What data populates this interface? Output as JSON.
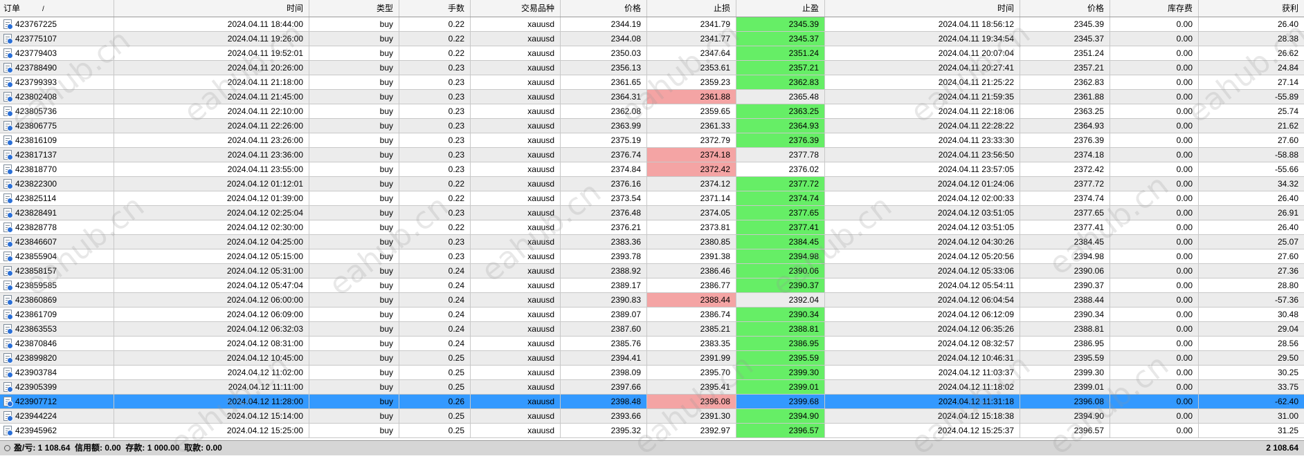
{
  "columns": {
    "order": "订单",
    "sort_indicator": "/",
    "time_open": "时间",
    "type": "类型",
    "lots": "手数",
    "symbol": "交易品种",
    "price_open": "价格",
    "sl": "止损",
    "tp": "止盈",
    "time_close": "时间",
    "price_close": "价格",
    "swap": "库存费",
    "profit": "获利"
  },
  "colors": {
    "tp_hit": "#66ee66",
    "sl_hit": "#f4a4a4",
    "selected_row": "#3399ff"
  },
  "icons": {
    "row_icon": "document-icon",
    "summary_icon": "circle-icon"
  },
  "selected_index": 26,
  "rows": [
    {
      "order": "423767225",
      "time_open": "2024.04.11 18:44:00",
      "type": "buy",
      "lots": "0.22",
      "symbol": "xauusd",
      "price_open": "2344.19",
      "sl": "2341.79",
      "tp": "2345.39",
      "time_close": "2024.04.11 18:56:12",
      "price_close": "2345.39",
      "swap": "0.00",
      "profit": "26.40",
      "hit": "tp"
    },
    {
      "order": "423775107",
      "time_open": "2024.04.11 19:26:00",
      "type": "buy",
      "lots": "0.22",
      "symbol": "xauusd",
      "price_open": "2344.08",
      "sl": "2341.77",
      "tp": "2345.37",
      "time_close": "2024.04.11 19:34:54",
      "price_close": "2345.37",
      "swap": "0.00",
      "profit": "28.38",
      "hit": "tp"
    },
    {
      "order": "423779403",
      "time_open": "2024.04.11 19:52:01",
      "type": "buy",
      "lots": "0.22",
      "symbol": "xauusd",
      "price_open": "2350.03",
      "sl": "2347.64",
      "tp": "2351.24",
      "time_close": "2024.04.11 20:07:04",
      "price_close": "2351.24",
      "swap": "0.00",
      "profit": "26.62",
      "hit": "tp"
    },
    {
      "order": "423788490",
      "time_open": "2024.04.11 20:26:00",
      "type": "buy",
      "lots": "0.23",
      "symbol": "xauusd",
      "price_open": "2356.13",
      "sl": "2353.61",
      "tp": "2357.21",
      "time_close": "2024.04.11 20:27:41",
      "price_close": "2357.21",
      "swap": "0.00",
      "profit": "24.84",
      "hit": "tp"
    },
    {
      "order": "423799393",
      "time_open": "2024.04.11 21:18:00",
      "type": "buy",
      "lots": "0.23",
      "symbol": "xauusd",
      "price_open": "2361.65",
      "sl": "2359.23",
      "tp": "2362.83",
      "time_close": "2024.04.11 21:25:22",
      "price_close": "2362.83",
      "swap": "0.00",
      "profit": "27.14",
      "hit": "tp"
    },
    {
      "order": "423802408",
      "time_open": "2024.04.11 21:45:00",
      "type": "buy",
      "lots": "0.23",
      "symbol": "xauusd",
      "price_open": "2364.31",
      "sl": "2361.88",
      "tp": "2365.48",
      "time_close": "2024.04.11 21:59:35",
      "price_close": "2361.88",
      "swap": "0.00",
      "profit": "-55.89",
      "hit": "sl"
    },
    {
      "order": "423805736",
      "time_open": "2024.04.11 22:10:00",
      "type": "buy",
      "lots": "0.23",
      "symbol": "xauusd",
      "price_open": "2362.08",
      "sl": "2359.65",
      "tp": "2363.25",
      "time_close": "2024.04.11 22:18:06",
      "price_close": "2363.25",
      "swap": "0.00",
      "profit": "25.74",
      "hit": "tp"
    },
    {
      "order": "423806775",
      "time_open": "2024.04.11 22:26:00",
      "type": "buy",
      "lots": "0.23",
      "symbol": "xauusd",
      "price_open": "2363.99",
      "sl": "2361.33",
      "tp": "2364.93",
      "time_close": "2024.04.11 22:28:22",
      "price_close": "2364.93",
      "swap": "0.00",
      "profit": "21.62",
      "hit": "tp"
    },
    {
      "order": "423816109",
      "time_open": "2024.04.11 23:26:00",
      "type": "buy",
      "lots": "0.23",
      "symbol": "xauusd",
      "price_open": "2375.19",
      "sl": "2372.79",
      "tp": "2376.39",
      "time_close": "2024.04.11 23:33:30",
      "price_close": "2376.39",
      "swap": "0.00",
      "profit": "27.60",
      "hit": "tp"
    },
    {
      "order": "423817137",
      "time_open": "2024.04.11 23:36:00",
      "type": "buy",
      "lots": "0.23",
      "symbol": "xauusd",
      "price_open": "2376.74",
      "sl": "2374.18",
      "tp": "2377.78",
      "time_close": "2024.04.11 23:56:50",
      "price_close": "2374.18",
      "swap": "0.00",
      "profit": "-58.88",
      "hit": "sl"
    },
    {
      "order": "423818770",
      "time_open": "2024.04.11 23:55:00",
      "type": "buy",
      "lots": "0.23",
      "symbol": "xauusd",
      "price_open": "2374.84",
      "sl": "2372.42",
      "tp": "2376.02",
      "time_close": "2024.04.11 23:57:05",
      "price_close": "2372.42",
      "swap": "0.00",
      "profit": "-55.66",
      "hit": "sl"
    },
    {
      "order": "423822300",
      "time_open": "2024.04.12 01:12:01",
      "type": "buy",
      "lots": "0.22",
      "symbol": "xauusd",
      "price_open": "2376.16",
      "sl": "2374.12",
      "tp": "2377.72",
      "time_close": "2024.04.12 01:24:06",
      "price_close": "2377.72",
      "swap": "0.00",
      "profit": "34.32",
      "hit": "tp"
    },
    {
      "order": "423825114",
      "time_open": "2024.04.12 01:39:00",
      "type": "buy",
      "lots": "0.22",
      "symbol": "xauusd",
      "price_open": "2373.54",
      "sl": "2371.14",
      "tp": "2374.74",
      "time_close": "2024.04.12 02:00:33",
      "price_close": "2374.74",
      "swap": "0.00",
      "profit": "26.40",
      "hit": "tp"
    },
    {
      "order": "423828491",
      "time_open": "2024.04.12 02:25:04",
      "type": "buy",
      "lots": "0.23",
      "symbol": "xauusd",
      "price_open": "2376.48",
      "sl": "2374.05",
      "tp": "2377.65",
      "time_close": "2024.04.12 03:51:05",
      "price_close": "2377.65",
      "swap": "0.00",
      "profit": "26.91",
      "hit": "tp"
    },
    {
      "order": "423828778",
      "time_open": "2024.04.12 02:30:00",
      "type": "buy",
      "lots": "0.22",
      "symbol": "xauusd",
      "price_open": "2376.21",
      "sl": "2373.81",
      "tp": "2377.41",
      "time_close": "2024.04.12 03:51:05",
      "price_close": "2377.41",
      "swap": "0.00",
      "profit": "26.40",
      "hit": "tp"
    },
    {
      "order": "423846607",
      "time_open": "2024.04.12 04:25:00",
      "type": "buy",
      "lots": "0.23",
      "symbol": "xauusd",
      "price_open": "2383.36",
      "sl": "2380.85",
      "tp": "2384.45",
      "time_close": "2024.04.12 04:30:26",
      "price_close": "2384.45",
      "swap": "0.00",
      "profit": "25.07",
      "hit": "tp"
    },
    {
      "order": "423855904",
      "time_open": "2024.04.12 05:15:00",
      "type": "buy",
      "lots": "0.23",
      "symbol": "xauusd",
      "price_open": "2393.78",
      "sl": "2391.38",
      "tp": "2394.98",
      "time_close": "2024.04.12 05:20:56",
      "price_close": "2394.98",
      "swap": "0.00",
      "profit": "27.60",
      "hit": "tp"
    },
    {
      "order": "423858157",
      "time_open": "2024.04.12 05:31:00",
      "type": "buy",
      "lots": "0.24",
      "symbol": "xauusd",
      "price_open": "2388.92",
      "sl": "2386.46",
      "tp": "2390.06",
      "time_close": "2024.04.12 05:33:06",
      "price_close": "2390.06",
      "swap": "0.00",
      "profit": "27.36",
      "hit": "tp"
    },
    {
      "order": "423859585",
      "time_open": "2024.04.12 05:47:04",
      "type": "buy",
      "lots": "0.24",
      "symbol": "xauusd",
      "price_open": "2389.17",
      "sl": "2386.77",
      "tp": "2390.37",
      "time_close": "2024.04.12 05:54:11",
      "price_close": "2390.37",
      "swap": "0.00",
      "profit": "28.80",
      "hit": "tp"
    },
    {
      "order": "423860869",
      "time_open": "2024.04.12 06:00:00",
      "type": "buy",
      "lots": "0.24",
      "symbol": "xauusd",
      "price_open": "2390.83",
      "sl": "2388.44",
      "tp": "2392.04",
      "time_close": "2024.04.12 06:04:54",
      "price_close": "2388.44",
      "swap": "0.00",
      "profit": "-57.36",
      "hit": "sl"
    },
    {
      "order": "423861709",
      "time_open": "2024.04.12 06:09:00",
      "type": "buy",
      "lots": "0.24",
      "symbol": "xauusd",
      "price_open": "2389.07",
      "sl": "2386.74",
      "tp": "2390.34",
      "time_close": "2024.04.12 06:12:09",
      "price_close": "2390.34",
      "swap": "0.00",
      "profit": "30.48",
      "hit": "tp"
    },
    {
      "order": "423863553",
      "time_open": "2024.04.12 06:32:03",
      "type": "buy",
      "lots": "0.24",
      "symbol": "xauusd",
      "price_open": "2387.60",
      "sl": "2385.21",
      "tp": "2388.81",
      "time_close": "2024.04.12 06:35:26",
      "price_close": "2388.81",
      "swap": "0.00",
      "profit": "29.04",
      "hit": "tp"
    },
    {
      "order": "423870846",
      "time_open": "2024.04.12 08:31:00",
      "type": "buy",
      "lots": "0.24",
      "symbol": "xauusd",
      "price_open": "2385.76",
      "sl": "2383.35",
      "tp": "2386.95",
      "time_close": "2024.04.12 08:32:57",
      "price_close": "2386.95",
      "swap": "0.00",
      "profit": "28.56",
      "hit": "tp"
    },
    {
      "order": "423899820",
      "time_open": "2024.04.12 10:45:00",
      "type": "buy",
      "lots": "0.25",
      "symbol": "xauusd",
      "price_open": "2394.41",
      "sl": "2391.99",
      "tp": "2395.59",
      "time_close": "2024.04.12 10:46:31",
      "price_close": "2395.59",
      "swap": "0.00",
      "profit": "29.50",
      "hit": "tp"
    },
    {
      "order": "423903784",
      "time_open": "2024.04.12 11:02:00",
      "type": "buy",
      "lots": "0.25",
      "symbol": "xauusd",
      "price_open": "2398.09",
      "sl": "2395.70",
      "tp": "2399.30",
      "time_close": "2024.04.12 11:03:37",
      "price_close": "2399.30",
      "swap": "0.00",
      "profit": "30.25",
      "hit": "tp"
    },
    {
      "order": "423905399",
      "time_open": "2024.04.12 11:11:00",
      "type": "buy",
      "lots": "0.25",
      "symbol": "xauusd",
      "price_open": "2397.66",
      "sl": "2395.41",
      "tp": "2399.01",
      "time_close": "2024.04.12 11:18:02",
      "price_close": "2399.01",
      "swap": "0.00",
      "profit": "33.75",
      "hit": "tp"
    },
    {
      "order": "423907712",
      "time_open": "2024.04.12 11:28:00",
      "type": "buy",
      "lots": "0.26",
      "symbol": "xauusd",
      "price_open": "2398.48",
      "sl": "2396.08",
      "tp": "2399.68",
      "time_close": "2024.04.12 11:31:18",
      "price_close": "2396.08",
      "swap": "0.00",
      "profit": "-62.40",
      "hit": "sl"
    },
    {
      "order": "423944224",
      "time_open": "2024.04.12 15:14:00",
      "type": "buy",
      "lots": "0.25",
      "symbol": "xauusd",
      "price_open": "2393.66",
      "sl": "2391.30",
      "tp": "2394.90",
      "time_close": "2024.04.12 15:18:38",
      "price_close": "2394.90",
      "swap": "0.00",
      "profit": "31.00",
      "hit": "tp"
    },
    {
      "order": "423945962",
      "time_open": "2024.04.12 15:25:00",
      "type": "buy",
      "lots": "0.25",
      "symbol": "xauusd",
      "price_open": "2395.32",
      "sl": "2392.97",
      "tp": "2396.57",
      "time_close": "2024.04.12 15:25:37",
      "price_close": "2396.57",
      "swap": "0.00",
      "profit": "31.25",
      "hit": "tp"
    }
  ],
  "summary": {
    "text": "盈/亏: 1 108.64  信用额: 0.00  存款: 1 000.00  取款: 0.00",
    "total": "2 108.64"
  },
  "watermark": "eahub.cn"
}
